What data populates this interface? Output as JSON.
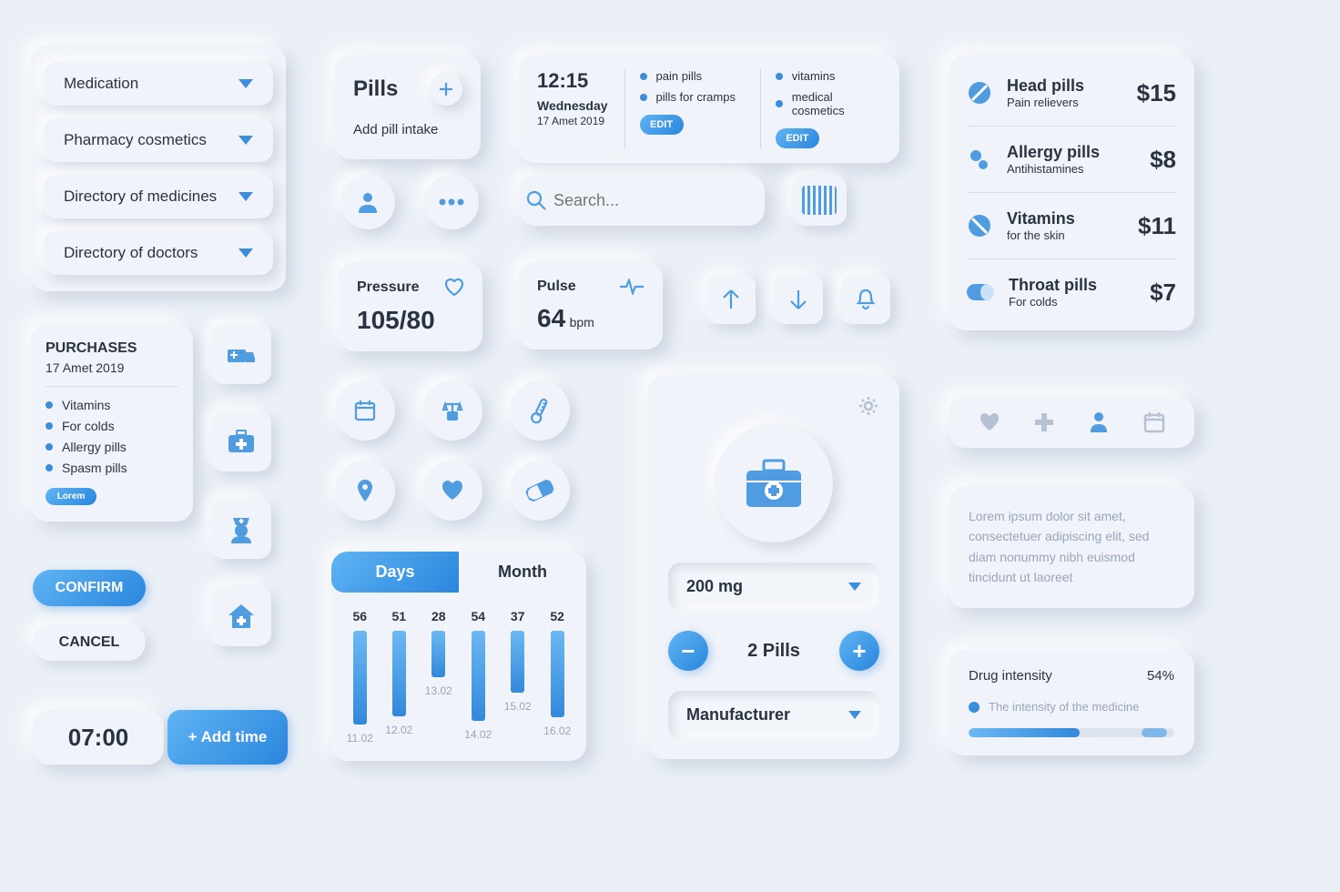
{
  "menu": {
    "items": [
      "Medication",
      "Pharmacy cosmetics",
      "Directory of medicines",
      "Directory of doctors"
    ]
  },
  "pills_card": {
    "title": "Pills",
    "subtitle": "Add pill intake"
  },
  "schedule": {
    "time": "12:15",
    "day": "Wednesday",
    "date": "17 Amet 2019",
    "col1": [
      "pain pills",
      "pills for cramps"
    ],
    "col2": [
      "vitamins",
      "medical cosmetics"
    ],
    "edit": "EDIT"
  },
  "search": {
    "placeholder": "Search..."
  },
  "pressure": {
    "label": "Pressure",
    "value": "105/80"
  },
  "pulse": {
    "label": "Pulse",
    "value": "64",
    "unit": "bpm"
  },
  "purchases": {
    "title": "PURCHASES",
    "date": "17 Amet 2019",
    "items": [
      "Vitamins",
      "For colds",
      "Allergy pills",
      "Spasm pills"
    ],
    "lorem": "Lorem"
  },
  "confirm": "CONFIRM",
  "cancel": "CANCEL",
  "time_card": {
    "time": "07:00",
    "add": "+ Add time"
  },
  "chart": {
    "tabs": [
      "Days",
      "Month"
    ]
  },
  "chart_data": {
    "type": "bar",
    "categories": [
      "11.02",
      "12.02",
      "13.02",
      "14.02",
      "15.02",
      "16.02"
    ],
    "values": [
      56,
      51,
      28,
      54,
      37,
      52
    ],
    "ylim": [
      0,
      60
    ]
  },
  "dosage": {
    "select": "200 mg",
    "count": "2 Pills",
    "manufacturer": "Manufacturer"
  },
  "products": [
    {
      "name": "Head pills",
      "sub": "Pain relievers",
      "price": "$15"
    },
    {
      "name": "Allergy pills",
      "sub": "Antihistamines",
      "price": "$8"
    },
    {
      "name": "Vitamins",
      "sub": "for the skin",
      "price": "$11"
    },
    {
      "name": "Throat pills",
      "sub": "For colds",
      "price": "$7"
    }
  ],
  "desc": "Lorem ipsum dolor sit amet, consectetuer adipiscing elit, sed diam nonummy nibh euismod tincidunt ut laoreet",
  "intensity": {
    "label": "Drug intensity",
    "value": "54%",
    "sub": "The intensity of the medicine"
  }
}
